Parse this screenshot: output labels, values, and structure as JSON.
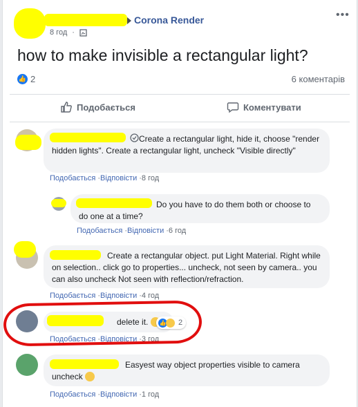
{
  "post": {
    "group_name": "Corona Render",
    "time": "8 год",
    "title": "how to make invisible a rectangular light?",
    "likes": "2",
    "comments_count": "6 коментарів",
    "like_action": "Подобається",
    "comment_action": "Коментувати"
  },
  "comments": [
    {
      "text": "Create a rectangular light, hide it, choose \"render hidden lights\". Create a rectangular light, uncheck \"Visible directly\"",
      "like": "Подобається",
      "reply": "Відповісти",
      "time": "8 год"
    },
    {
      "text": "Do you have to do them both or choose to do one at a time?",
      "like": "Подобається",
      "reply": "Відповісти",
      "time": "6 год"
    },
    {
      "text": "Create a rectangular object. put Light Material. Right while on selection.. click go to properties... uncheck, not seen by camera.. you can also uncheck Not seen with reflection/refraction.",
      "like": "Подобається",
      "reply": "Відповісти",
      "time": "4 год"
    },
    {
      "text": "delete it.",
      "reactions": "2",
      "like": "Подобається",
      "reply": "Відповісти",
      "time": "3 год"
    },
    {
      "text": "Easyest way object properties visible to camera uncheck",
      "like": "Подобається",
      "reply": "Відповісти",
      "time": "1 год"
    }
  ],
  "icons": [
    "globe-icon",
    "more-icon",
    "like-icon",
    "comment-icon",
    "verified-icon",
    "smile-emoji",
    "haha-emoji"
  ]
}
